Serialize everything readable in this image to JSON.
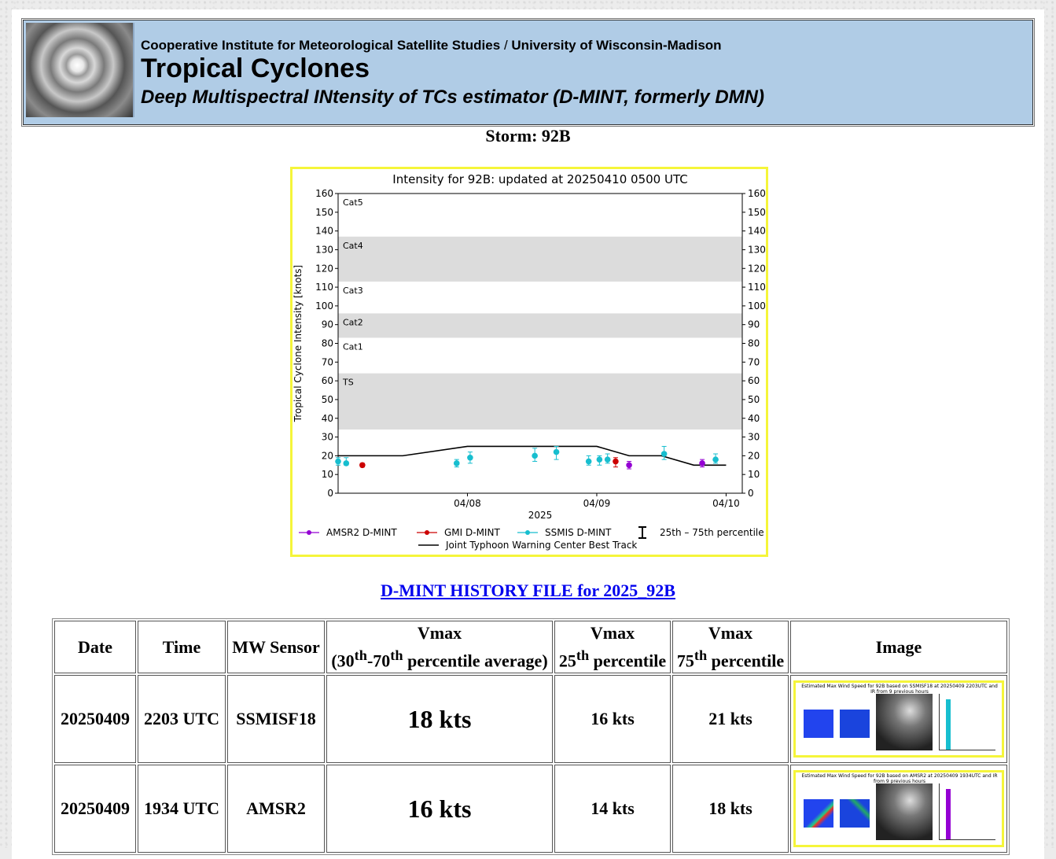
{
  "header": {
    "institution_left": "Cooperative Institute for Meteorological Satellite Studies",
    "institution_sep": "/",
    "institution_right": "University of Wisconsin-Madison",
    "title": "Tropical Cyclones",
    "subtitle": "Deep Multispectral INtensity of TCs estimator (D-MINT, formerly DMN)"
  },
  "storm_label": "Storm: 92B",
  "history_link": "D-MINT HISTORY FILE for 2025_92B",
  "chart_data": {
    "type": "scatter",
    "title": "Intensity for 92B: updated at 20250410 0500 UTC",
    "ylabel": "Tropical Cyclone Intensity [knots]",
    "xlabel": "2025",
    "ylim": [
      0,
      160
    ],
    "yticks": [
      0,
      10,
      20,
      30,
      40,
      50,
      60,
      70,
      80,
      90,
      100,
      110,
      120,
      130,
      140,
      150,
      160
    ],
    "xlim": [
      "2025-04-07T00:00",
      "2025-04-10T03:00"
    ],
    "xticks": [
      {
        "x": "2025-04-08T00:00",
        "label": "04/08"
      },
      {
        "x": "2025-04-09T00:00",
        "label": "04/09"
      },
      {
        "x": "2025-04-10T00:00",
        "label": "04/10"
      }
    ],
    "category_bands": [
      {
        "name": "TS",
        "min": 34,
        "max": 64,
        "shaded": true
      },
      {
        "name": "Cat1",
        "min": 64,
        "max": 83,
        "shaded": false
      },
      {
        "name": "Cat2",
        "min": 83,
        "max": 96,
        "shaded": true
      },
      {
        "name": "Cat3",
        "min": 96,
        "max": 113,
        "shaded": false
      },
      {
        "name": "Cat4",
        "min": 113,
        "max": 137,
        "shaded": true
      },
      {
        "name": "Cat5",
        "min": 137,
        "max": 160,
        "shaded": false
      }
    ],
    "series": [
      {
        "name": "AMSR2 D-MINT",
        "color": "#9400d3",
        "points": [
          {
            "x": "2025-04-09T06:00",
            "y": 15,
            "lo": 13,
            "hi": 17
          },
          {
            "x": "2025-04-09T19:34",
            "y": 16,
            "lo": 14,
            "hi": 18
          }
        ]
      },
      {
        "name": "GMI D-MINT",
        "color": "#cc0000",
        "points": [
          {
            "x": "2025-04-07T04:30",
            "y": 15,
            "lo": 14,
            "hi": 16
          },
          {
            "x": "2025-04-09T03:30",
            "y": 17,
            "lo": 14,
            "hi": 19
          }
        ]
      },
      {
        "name": "SSMIS D-MINT",
        "color": "#17becf",
        "points": [
          {
            "x": "2025-04-07T00:00",
            "y": 17,
            "lo": 15,
            "hi": 19
          },
          {
            "x": "2025-04-07T01:30",
            "y": 16,
            "lo": 15,
            "hi": 19
          },
          {
            "x": "2025-04-07T22:00",
            "y": 16,
            "lo": 14,
            "hi": 18
          },
          {
            "x": "2025-04-08T00:30",
            "y": 19,
            "lo": 16,
            "hi": 22
          },
          {
            "x": "2025-04-08T12:30",
            "y": 20,
            "lo": 17,
            "hi": 24
          },
          {
            "x": "2025-04-08T16:30",
            "y": 22,
            "lo": 18,
            "hi": 25
          },
          {
            "x": "2025-04-08T22:30",
            "y": 17,
            "lo": 15,
            "hi": 20
          },
          {
            "x": "2025-04-09T00:30",
            "y": 18,
            "lo": 15,
            "hi": 20
          },
          {
            "x": "2025-04-09T02:00",
            "y": 18,
            "lo": 16,
            "hi": 21
          },
          {
            "x": "2025-04-09T12:30",
            "y": 21,
            "lo": 18,
            "hi": 25
          },
          {
            "x": "2025-04-09T22:03",
            "y": 18,
            "lo": 16,
            "hi": 21
          }
        ]
      },
      {
        "name": "Joint Typhoon Warning Center Best Track",
        "color": "#000000",
        "line": [
          {
            "x": "2025-04-07T00:00",
            "y": 20
          },
          {
            "x": "2025-04-07T06:00",
            "y": 20
          },
          {
            "x": "2025-04-07T12:00",
            "y": 20
          },
          {
            "x": "2025-04-08T00:00",
            "y": 25
          },
          {
            "x": "2025-04-09T00:00",
            "y": 25
          },
          {
            "x": "2025-04-09T06:00",
            "y": 20
          },
          {
            "x": "2025-04-09T12:00",
            "y": 20
          },
          {
            "x": "2025-04-09T18:00",
            "y": 15
          },
          {
            "x": "2025-04-10T00:00",
            "y": 15
          }
        ]
      }
    ],
    "legend_percentile_label": "25th – 75th percentile",
    "legend_position": "bottom"
  },
  "table": {
    "headers": {
      "date": "Date",
      "time": "Time",
      "sensor": "MW Sensor",
      "vmax_title": "Vmax",
      "vmax_sub_a": "(30",
      "vmax_sub_th1": "th",
      "vmax_sub_b": "-70",
      "vmax_sub_th2": "th",
      "vmax_sub_c": " percentile average)",
      "p25_a": "25",
      "p25_th": "th",
      "p25_b": " percentile",
      "p75_a": "75",
      "p75_th": "th",
      "p75_b": " percentile",
      "image": "Image"
    },
    "rows": [
      {
        "date": "20250409",
        "time": "2203 UTC",
        "sensor": "SSMISF18",
        "vmax": "18 kts",
        "p25": "16 kts",
        "p75": "21 kts",
        "caption": "Estimated Max Wind Speed for 92B based on SSMISF18 at 20250409 2203UTC and IR from 9 previous hours"
      },
      {
        "date": "20250409",
        "time": "1934 UTC",
        "sensor": "AMSR2",
        "vmax": "16 kts",
        "p25": "14 kts",
        "p75": "18 kts",
        "caption": "Estimated Max Wind Speed for 92B based on AMSR2 at 20250409 1934UTC and IR from 9 previous hours"
      }
    ]
  }
}
